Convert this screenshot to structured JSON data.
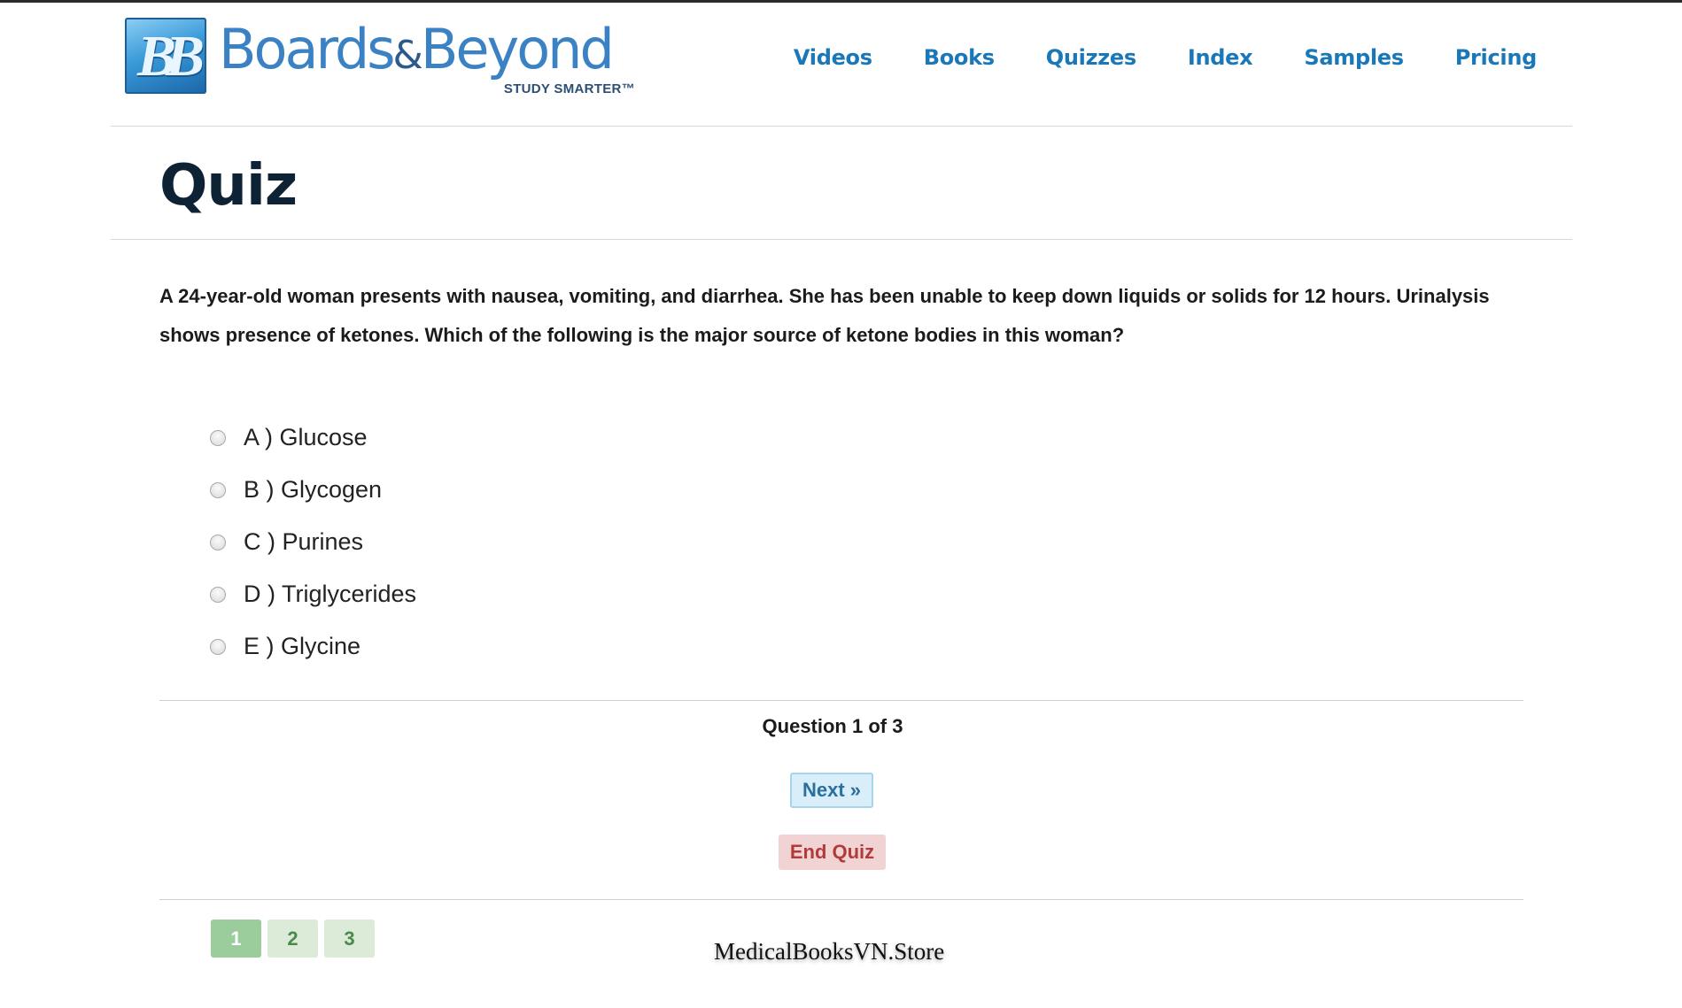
{
  "brand": {
    "logo_mark": "BB",
    "name_part1": "Boards",
    "name_amp": "&",
    "name_part2": "Beyond",
    "tagline": "STUDY SMARTER™"
  },
  "nav": {
    "items": [
      "Videos",
      "Books",
      "Quizzes",
      "Index",
      "Samples",
      "Pricing"
    ]
  },
  "page": {
    "title": "Quiz"
  },
  "quiz": {
    "question_text": "A 24-year-old woman presents with nausea, vomiting, and diarrhea. She has been unable to keep down liquids or solids for 12 hours. Urinalysis shows presence of ketones. Which of the following is the major source of ketone bodies in this woman?",
    "answers": [
      "A ) Glucose",
      "B ) Glycogen",
      "C ) Purines",
      "D ) Triglycerides",
      "E ) Glycine"
    ],
    "progress_label": "Question 1 of 3",
    "next_label": "Next »",
    "end_label": "End Quiz",
    "pages": [
      "1",
      "2",
      "3"
    ],
    "current_page": "1"
  },
  "watermark": "MedicalBooksVN.Store",
  "colors": {
    "nav_link": "#1a78b8",
    "title": "#0e2236",
    "next_bg": "#d9eef8",
    "end_bg": "#f1d3d3",
    "end_text": "#b13b3b",
    "page_active": "#9bcc9b",
    "page_idle": "#dcebd8"
  }
}
